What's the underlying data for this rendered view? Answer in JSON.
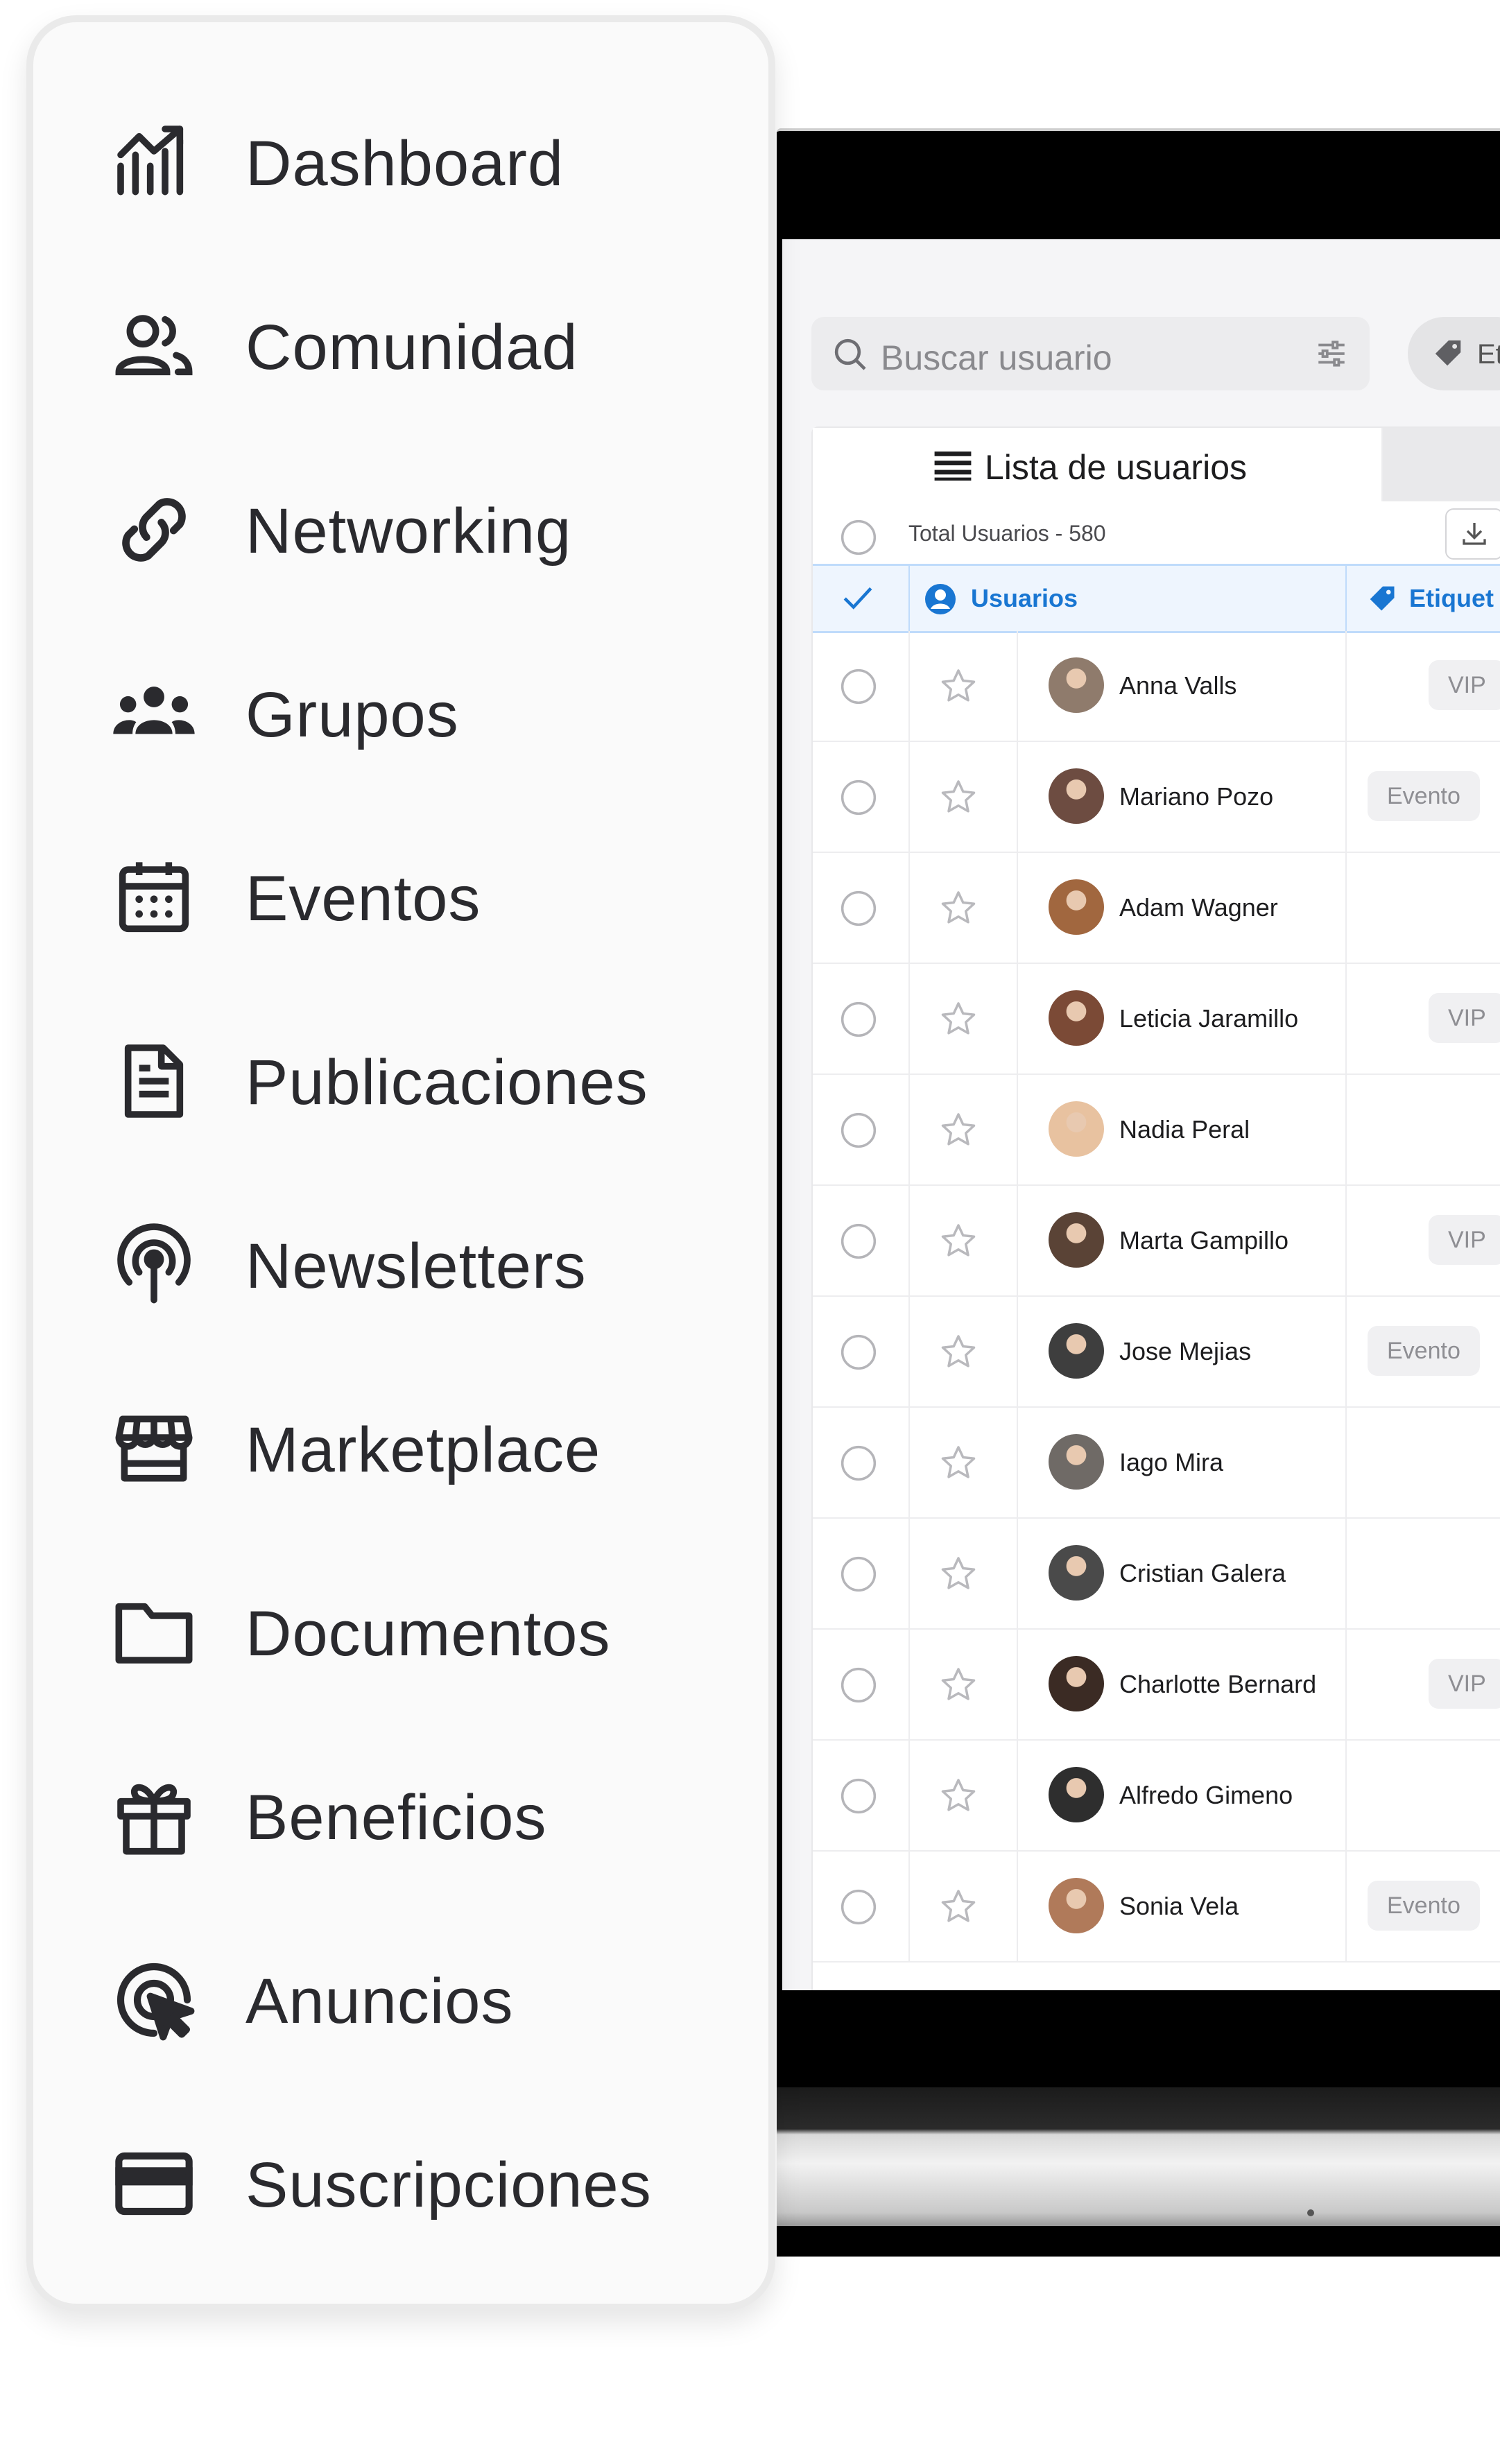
{
  "sidebar": {
    "items": [
      {
        "label": "Dashboard",
        "icon": "chart-growth-icon"
      },
      {
        "label": "Comunidad",
        "icon": "users-icon"
      },
      {
        "label": "Networking",
        "icon": "link-icon"
      },
      {
        "label": "Grupos",
        "icon": "group-icon"
      },
      {
        "label": "Eventos",
        "icon": "calendar-icon"
      },
      {
        "label": "Publicaciones",
        "icon": "document-icon"
      },
      {
        "label": "Newsletters",
        "icon": "broadcast-icon"
      },
      {
        "label": "Marketplace",
        "icon": "store-icon"
      },
      {
        "label": "Documentos",
        "icon": "folder-icon"
      },
      {
        "label": "Beneficios",
        "icon": "gift-icon"
      },
      {
        "label": "Anuncios",
        "icon": "cursor-click-icon"
      },
      {
        "label": "Suscripciones",
        "icon": "credit-card-icon"
      }
    ]
  },
  "search": {
    "placeholder": "Buscar usuario"
  },
  "tag_filter": {
    "label": "Et"
  },
  "tabs": {
    "active": "Lista de usuarios"
  },
  "summary": {
    "total_label": "Total Usuarios - 580"
  },
  "table": {
    "columns": {
      "users": "Usuarios",
      "tags": "Etiquet"
    },
    "rows": [
      {
        "name": "Anna Valls",
        "tag": "VIP",
        "avatar_color": "#8f7b6c"
      },
      {
        "name": "Mariano Pozo",
        "tag": "Evento",
        "avatar_color": "#6d4c41"
      },
      {
        "name": "Adam Wagner",
        "tag": "",
        "avatar_color": "#a1673f"
      },
      {
        "name": "Leticia Jaramillo",
        "tag": "VIP",
        "avatar_color": "#7b4a36"
      },
      {
        "name": "Nadia Peral",
        "tag": "",
        "avatar_color": "#e8c2a0"
      },
      {
        "name": "Marta Gampillo",
        "tag": "VIP",
        "avatar_color": "#5a4336"
      },
      {
        "name": "Jose Mejias",
        "tag": "Evento",
        "avatar_color": "#3e3e3e"
      },
      {
        "name": "Iago Mira",
        "tag": "",
        "avatar_color": "#6f6a66"
      },
      {
        "name": "Cristian Galera",
        "tag": "",
        "avatar_color": "#4a4a4a"
      },
      {
        "name": "Charlotte Bernard",
        "tag": "VIP",
        "avatar_color": "#3b2b24"
      },
      {
        "name": "Alfredo Gimeno",
        "tag": "",
        "avatar_color": "#2e2e2e"
      },
      {
        "name": "Sonia Vela",
        "tag": "Evento",
        "avatar_color": "#b07a5a"
      }
    ]
  },
  "colors": {
    "accent": "#1976d2",
    "header_bg": "#eef5fe",
    "text": "#2a2a2e"
  }
}
